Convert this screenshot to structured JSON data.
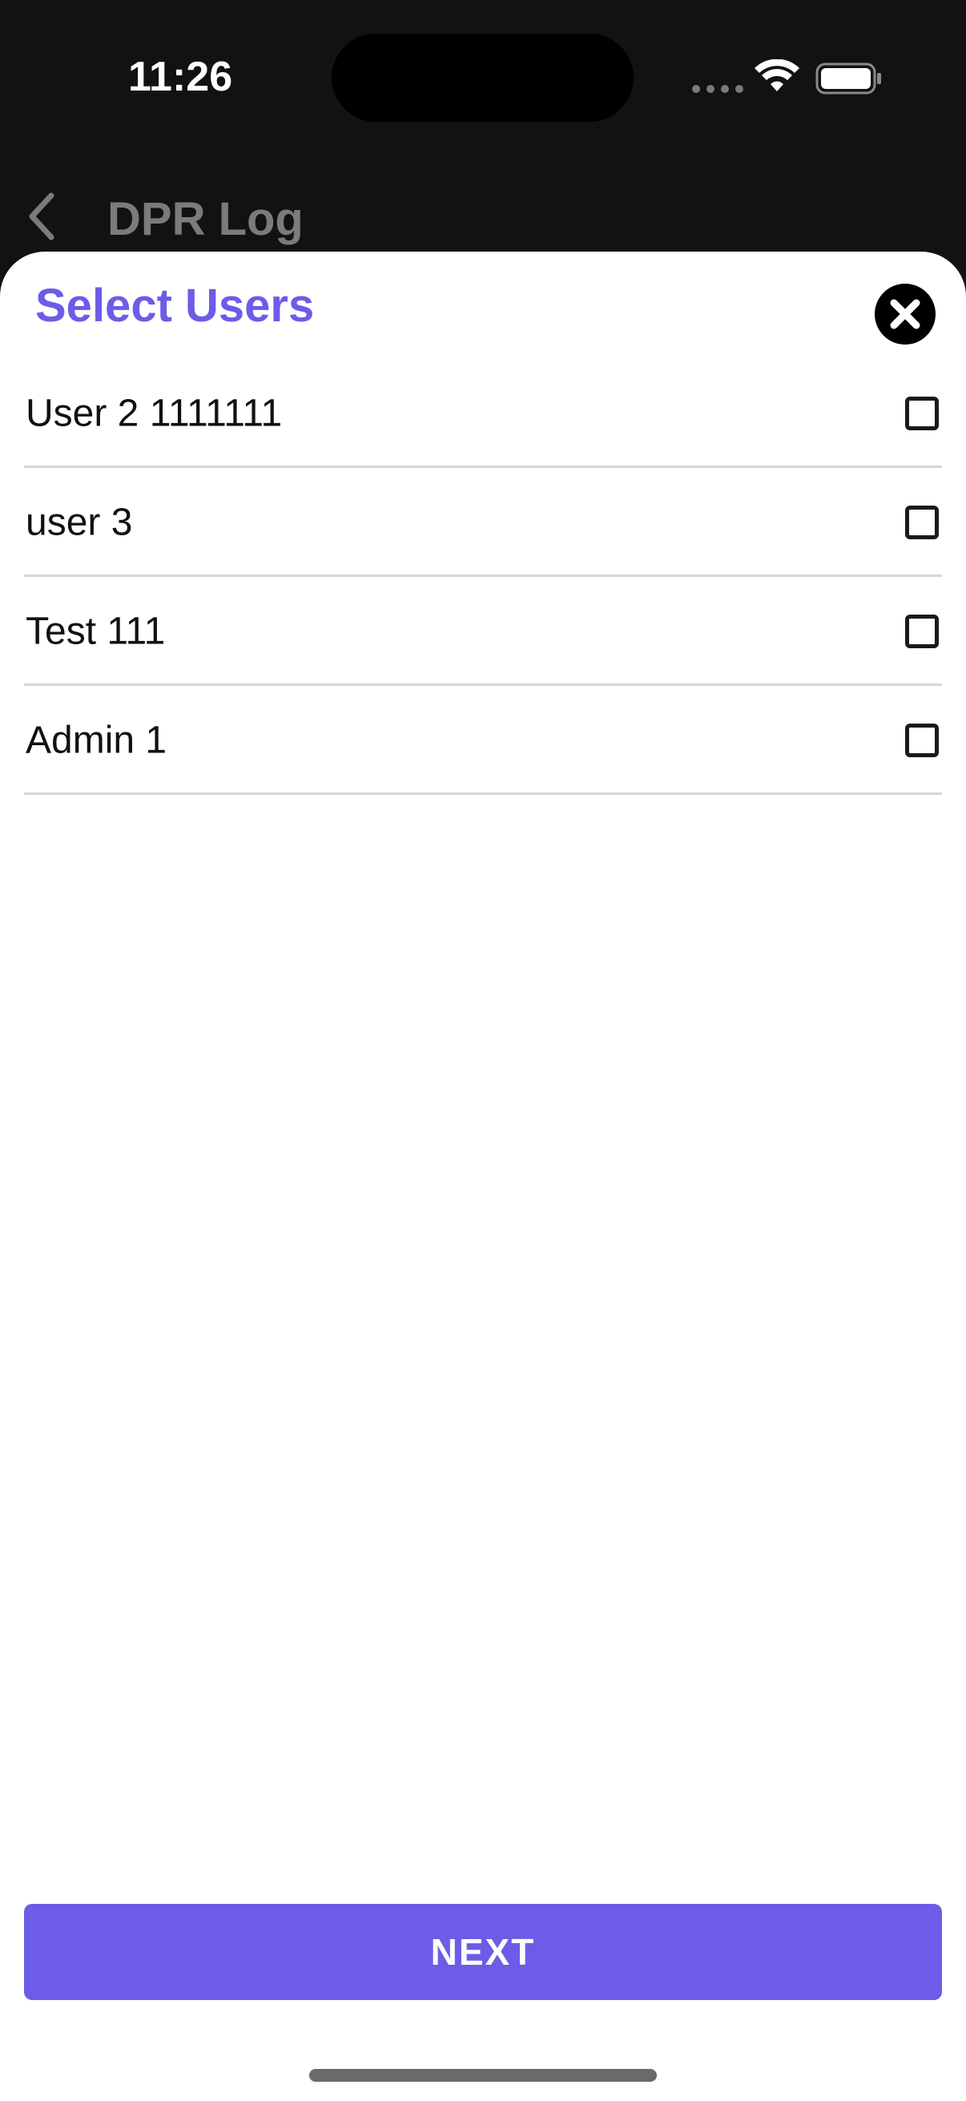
{
  "status_bar": {
    "time": "11:26",
    "icons": [
      "cellular-dots-icon",
      "wifi-icon",
      "battery-icon"
    ]
  },
  "nav": {
    "back_icon": "chevron-left-icon",
    "title": "DPR Log"
  },
  "sheet": {
    "title": "Select Users",
    "close_icon": "close-icon",
    "users": [
      {
        "label": "User 2 1111111",
        "checked": false
      },
      {
        "label": "user 3",
        "checked": false
      },
      {
        "label": "Test 111",
        "checked": false
      },
      {
        "label": "Admin 1",
        "checked": false
      }
    ],
    "next_label": "NEXT"
  },
  "colors": {
    "accent": "#6c5ce7",
    "background_dark": "#121212",
    "sheet_background": "#ffffff",
    "divider": "#d6d6d6"
  }
}
